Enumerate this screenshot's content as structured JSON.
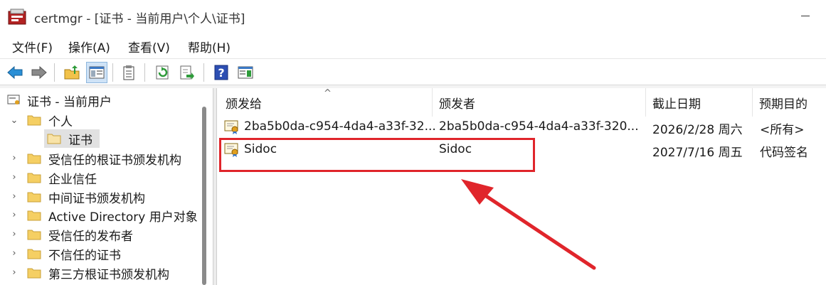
{
  "window": {
    "title": "certmgr - [证书 - 当前用户\\个人\\证书]"
  },
  "menu": {
    "file": "文件(F)",
    "action": "操作(A)",
    "view": "查看(V)",
    "help": "帮助(H)"
  },
  "toolbar": {
    "buttons": [
      "back-icon",
      "forward-icon",
      "up-folder-icon",
      "show-hide-tree-icon",
      "properties-icon",
      "refresh-icon",
      "export-list-icon",
      "help-icon",
      "action-pane-icon"
    ]
  },
  "tree": {
    "root": "证书 - 当前用户",
    "personal": "个人",
    "certificates": "证书",
    "items": [
      "受信任的根证书颁发机构",
      "企业信任",
      "中间证书颁发机构",
      "Active Directory 用户对象",
      "受信任的发布者",
      "不信任的证书",
      "第三方根证书颁发机构"
    ]
  },
  "list": {
    "columns": {
      "issued_to": "颁发给",
      "issued_by": "颁发者",
      "expiration": "截止日期",
      "purpose": "预期目的"
    },
    "rows": [
      {
        "issued_to": "2ba5b0da-c954-4da4-a33f-32...",
        "issued_by": "2ba5b0da-c954-4da4-a33f-320...",
        "expiration": "2026/2/28 周六",
        "purpose": "<所有>"
      },
      {
        "issued_to": "Sidoc",
        "issued_by": "Sidoc",
        "expiration": "2027/7/16 周五",
        "purpose": "代码签名"
      }
    ]
  },
  "colors": {
    "annotation": "#e0252b",
    "selection": "#e1e1e1"
  }
}
